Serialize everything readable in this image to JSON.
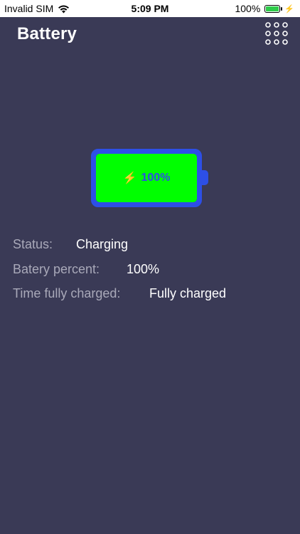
{
  "status_bar": {
    "carrier": "Invalid SIM",
    "time": "5:09 PM",
    "battery_percent": "100%",
    "battery_fill_fraction": 1.0
  },
  "header": {
    "title": "Battery",
    "menu_icon": "grid-dots-icon"
  },
  "battery": {
    "label": "100%",
    "charging_icon": "lightning-bolt-icon",
    "level_fraction": 1.0,
    "colors": {
      "fill": "#00ff00",
      "frame": "#2d4fe6"
    }
  },
  "info": {
    "status_label": "Status:",
    "status_value": "Charging",
    "percent_label": "Batery percent:",
    "percent_value": "100%",
    "time_label": "Time fully charged:",
    "time_value": "Fully charged"
  },
  "colors": {
    "background": "#3a3a56",
    "label_text": "#a9a9b9",
    "value_text": "#ffffff"
  }
}
